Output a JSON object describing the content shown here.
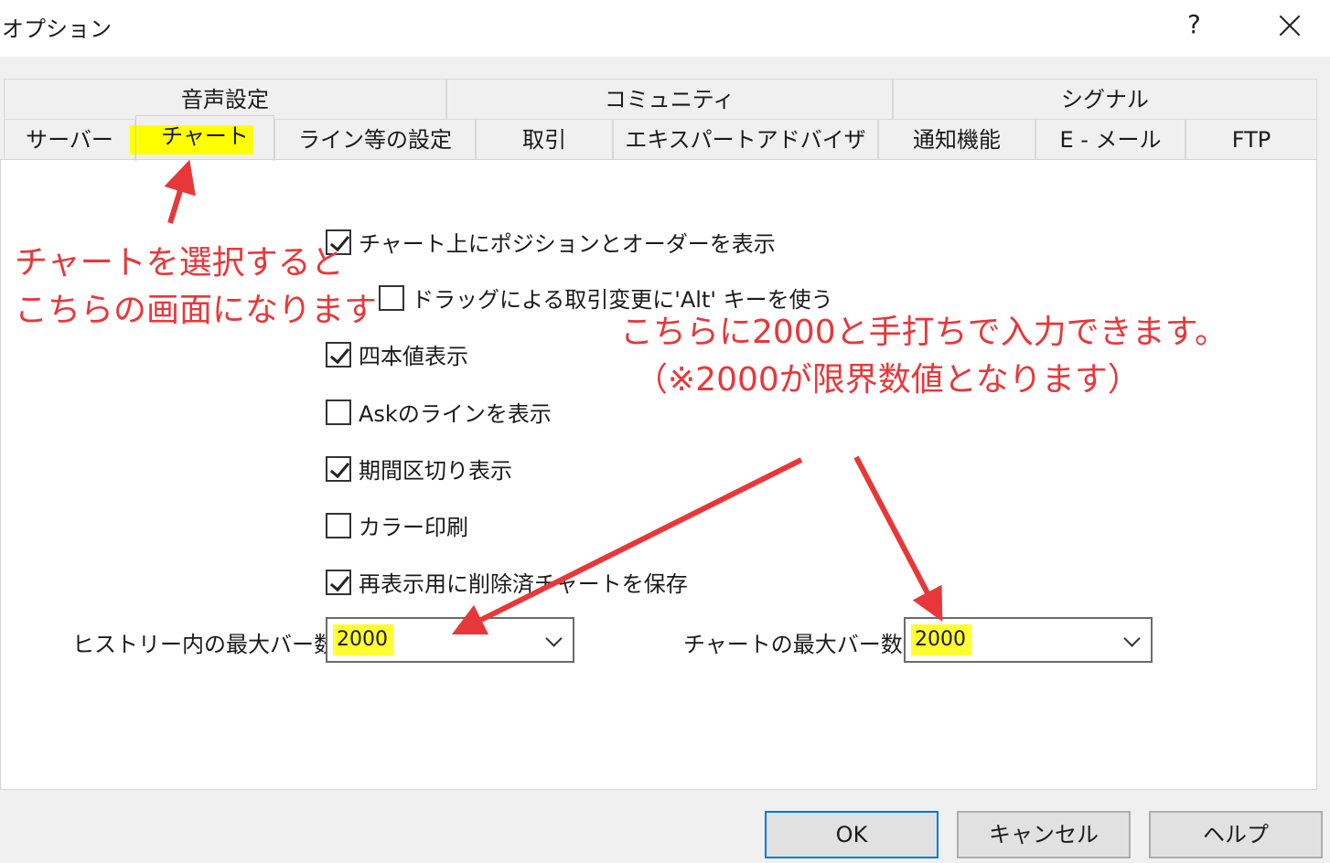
{
  "window": {
    "title": "オプション",
    "help_label": "?",
    "close_icon": "close-icon"
  },
  "tabs_row1": [
    "音声設定",
    "コミュニティ",
    "シグナル"
  ],
  "tabs_row2": [
    "サーバー",
    "チャート",
    "ライン等の設定",
    "取引",
    "エキスパートアドバイザ",
    "通知機能",
    "E - メール",
    "FTP"
  ],
  "active_tab": "チャート",
  "chart_tab": {
    "checkboxes": [
      {
        "label": "チャート上にポジションとオーダーを表示",
        "checked": true
      },
      {
        "label": "ドラッグによる取引変更に'Alt' キーを使う",
        "checked": false
      },
      {
        "label": "四本値表示",
        "checked": true
      },
      {
        "label": "Askのラインを表示",
        "checked": false
      },
      {
        "label": "期間区切り表示",
        "checked": true
      },
      {
        "label": "カラー印刷",
        "checked": false
      },
      {
        "label": "再表示用に削除済チャートを保存",
        "checked": true
      }
    ],
    "history_max_bars_label": "ヒストリー内の最大バー数",
    "history_max_bars_value": "2000",
    "chart_max_bars_label": "チャートの最大バー数：",
    "chart_max_bars_value": "2000"
  },
  "buttons": {
    "ok": "OK",
    "cancel": "キャンセル",
    "help": "ヘルプ"
  },
  "annotations": {
    "select_chart_line1": "チャートを選択すると",
    "select_chart_line2": "こちらの画面になります",
    "input_line1": "こちらに2000と手打ちで入力できます。",
    "input_line2": "（※2000が限界数値となります）"
  },
  "colors": {
    "annotation": "#e8373a",
    "highlight": "#ffff00",
    "default_button_border": "#0078d7"
  }
}
